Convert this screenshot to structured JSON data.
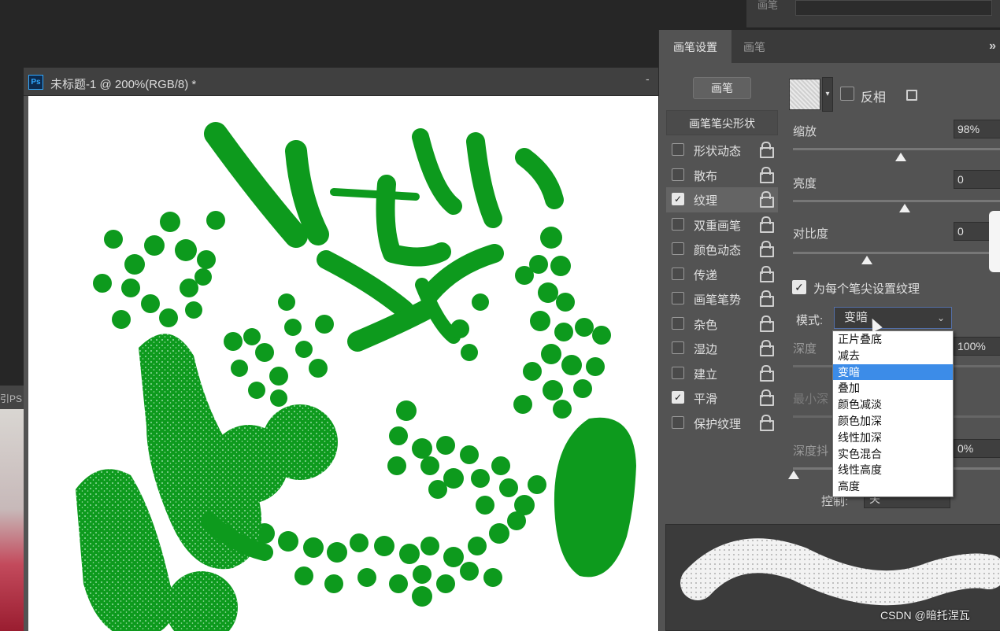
{
  "top_strip": {
    "label": "画笔"
  },
  "side_strip": {
    "text": "引PS"
  },
  "document": {
    "app_icon": "Ps",
    "title": "未标题-1 @ 200%(RGB/8) *",
    "minimize": "-",
    "stroke_color": "#0d9a1d"
  },
  "panel": {
    "tabs": [
      "画笔设置",
      "画笔"
    ],
    "menu_icon": "double-chevron-right-icon",
    "brushes_button": "画笔",
    "list_header": "画笔笔尖形状",
    "options": [
      {
        "label": "形状动态",
        "checked": false,
        "selected": false
      },
      {
        "label": "散布",
        "checked": false,
        "selected": false
      },
      {
        "label": "纹理",
        "checked": true,
        "selected": true
      },
      {
        "label": "双重画笔",
        "checked": false,
        "selected": false
      },
      {
        "label": "颜色动态",
        "checked": false,
        "selected": false
      },
      {
        "label": "传递",
        "checked": false,
        "selected": false
      },
      {
        "label": "画笔笔势",
        "checked": false,
        "selected": false
      },
      {
        "label": "杂色",
        "checked": false,
        "selected": false
      },
      {
        "label": "湿边",
        "checked": false,
        "selected": false
      },
      {
        "label": "建立",
        "checked": false,
        "selected": false
      },
      {
        "label": "平滑",
        "checked": true,
        "selected": false
      },
      {
        "label": "保护纹理",
        "checked": false,
        "selected": false
      }
    ],
    "invert_label": "反相",
    "invert_checked": false,
    "scale": {
      "label": "缩放",
      "value": "98%",
      "level": 0.5
    },
    "brightness": {
      "label": "亮度",
      "value": "0",
      "level": 0.5
    },
    "contrast": {
      "label": "对比度",
      "value": "0",
      "level": 0.34
    },
    "texture_each_tip": {
      "label": "为每个笔尖设置纹理",
      "checked": true
    },
    "mode": {
      "label": "模式:",
      "value": "变暗"
    },
    "depth": {
      "label": "深度",
      "value": "100%"
    },
    "min_depth": {
      "label": "最小深"
    },
    "depth_jitter": {
      "label": "深度抖",
      "value": "0%",
      "level": 0
    },
    "control": {
      "label": "控制:",
      "value": "关"
    }
  },
  "dropdown": {
    "items": [
      "正片叠底",
      "减去",
      "变暗",
      "叠加",
      "颜色减淡",
      "颜色加深",
      "线性加深",
      "实色混合",
      "线性高度",
      "高度"
    ],
    "highlighted_index": 2,
    "highlight_color": "#3c8ce8"
  },
  "watermark": "CSDN @暗托涅瓦"
}
